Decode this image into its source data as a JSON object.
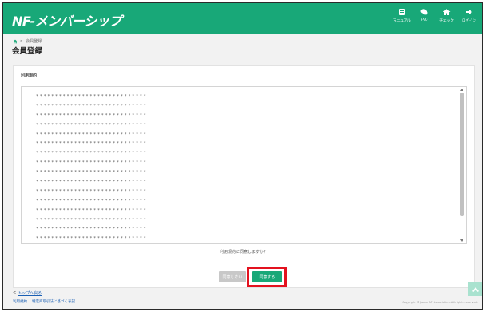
{
  "header": {
    "logo": "NF-メンバーシップ",
    "nav": [
      {
        "icon": "book-icon",
        "label": "マニュアル"
      },
      {
        "icon": "chat-icon",
        "label": "FAQ"
      },
      {
        "icon": "home-icon",
        "label": "チェック"
      },
      {
        "icon": "logout-icon",
        "label": "ログイン"
      }
    ]
  },
  "breadcrumb": {
    "icon": "home-icon",
    "separator": ">",
    "current": "会員登録"
  },
  "page_title": "会員登録",
  "terms": {
    "title": "利用規約",
    "lines": [
      "*****************************",
      "*****************************",
      "*****************************",
      "*****************************",
      "*****************************",
      "*****************************",
      "*****************************",
      "*****************************",
      "*****************************",
      "*****************************",
      "*****************************",
      "*****************************",
      "*****************************",
      "*****************************",
      "*****************************",
      "*****************************"
    ],
    "question": "利用規約に同意しますか？"
  },
  "buttons": {
    "disagree": "同意しない",
    "agree": "同意する"
  },
  "footer": {
    "back_arrow": "<",
    "back_label": "トップへ戻る",
    "links": [
      "利用規約",
      "特定商取引法に基づく表記"
    ],
    "copyright": "Copyright © Japan NF Association. All rights reserved."
  },
  "colors": {
    "brand": "#18a878",
    "highlight": "#e3121f",
    "link": "#1a5fb4"
  }
}
